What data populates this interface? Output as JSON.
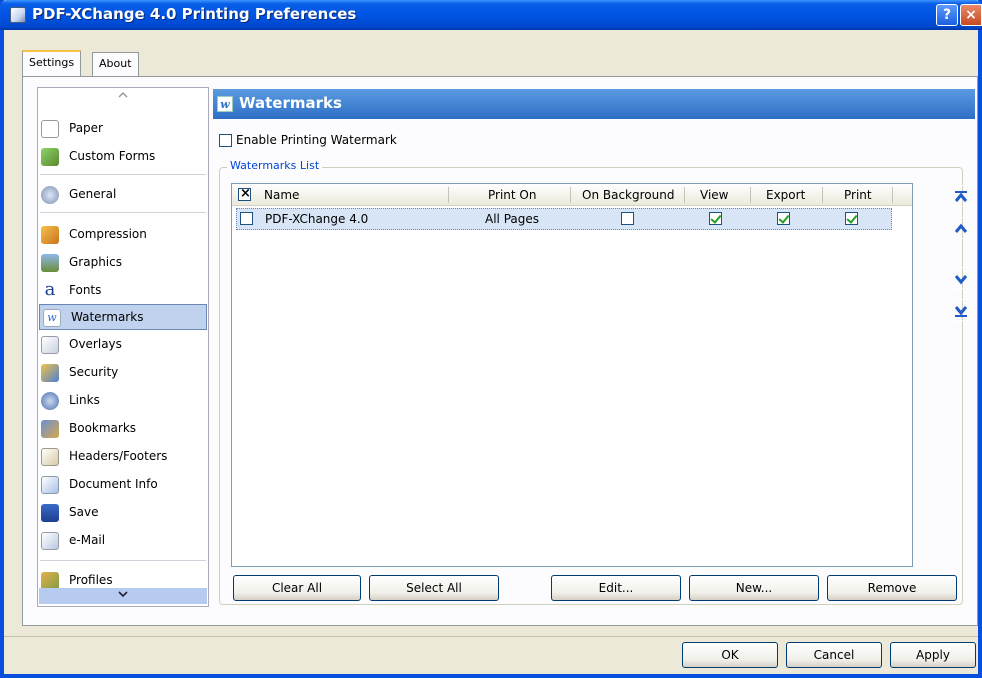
{
  "window": {
    "title": "PDF-XChange 4.0 Printing Preferences"
  },
  "tabs": [
    {
      "label": "Settings"
    },
    {
      "label": "About"
    }
  ],
  "nav": {
    "items": [
      {
        "label": "Paper",
        "icon": "paper-icon"
      },
      {
        "label": "Custom Forms",
        "icon": "custom-forms-icon"
      },
      {
        "label": "General",
        "icon": "general-icon"
      },
      {
        "label": "Compression",
        "icon": "compression-icon"
      },
      {
        "label": "Graphics",
        "icon": "graphics-icon"
      },
      {
        "label": "Fonts",
        "icon": "fonts-icon"
      },
      {
        "label": "Watermarks",
        "icon": "watermarks-icon"
      },
      {
        "label": "Overlays",
        "icon": "overlays-icon"
      },
      {
        "label": "Security",
        "icon": "security-icon"
      },
      {
        "label": "Links",
        "icon": "links-icon"
      },
      {
        "label": "Bookmarks",
        "icon": "bookmarks-icon"
      },
      {
        "label": "Headers/Footers",
        "icon": "headers-footers-icon"
      },
      {
        "label": "Document Info",
        "icon": "document-info-icon"
      },
      {
        "label": "Save",
        "icon": "save-icon"
      },
      {
        "label": "e-Mail",
        "icon": "email-icon"
      },
      {
        "label": "Profiles",
        "icon": "profiles-icon"
      }
    ],
    "selected": "Watermarks",
    "icon_glyphs": {
      "fonts": "a",
      "watermarks": "w"
    }
  },
  "panel": {
    "title": "Watermarks",
    "enable_label": "Enable Printing Watermark",
    "enable_checked": false,
    "group_label": "Watermarks List",
    "columns": [
      "Name",
      "Print On",
      "On Background",
      "View",
      "Export",
      "Print"
    ],
    "rows": [
      {
        "checked": false,
        "name": "PDF-XChange 4.0",
        "print_on": "All Pages",
        "on_background": false,
        "view": true,
        "export": true,
        "print": true
      }
    ],
    "buttons": {
      "clear_all": "Clear All",
      "select_all": "Select All",
      "edit": "Edit...",
      "new": "New...",
      "remove": "Remove"
    },
    "move_buttons": [
      "move-top-icon",
      "move-up-icon",
      "move-down-icon",
      "move-bottom-icon"
    ]
  },
  "footer": {
    "ok": "OK",
    "cancel": "Cancel",
    "apply": "Apply"
  },
  "colors": {
    "title_bar": "#0054e3",
    "panel_header": "#3d7ed0",
    "selection": "#c1d2ee",
    "accent_blue": "#0046d5"
  }
}
